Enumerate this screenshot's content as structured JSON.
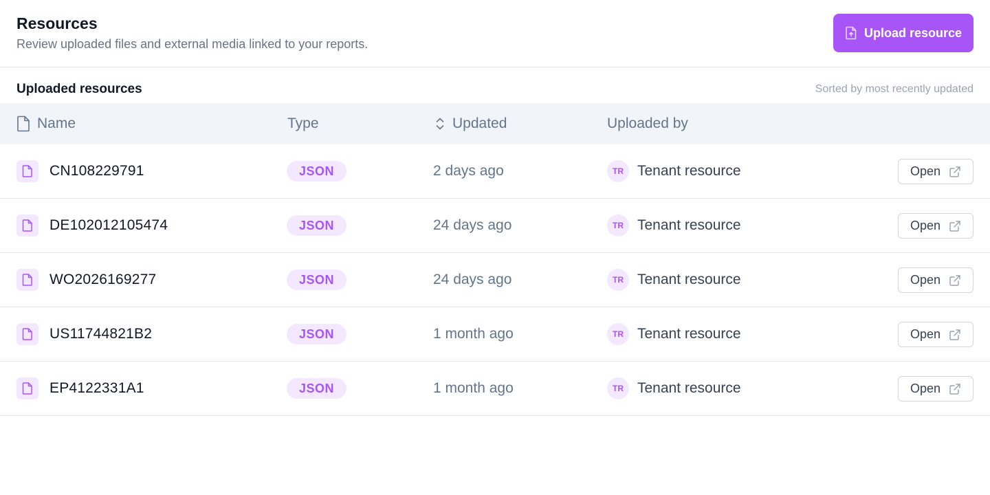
{
  "header": {
    "title": "Resources",
    "subtitle": "Review uploaded files and external media linked to your reports.",
    "upload_label": "Upload resource"
  },
  "section": {
    "title": "Uploaded resources",
    "sort_note": "Sorted by most recently updated"
  },
  "table": {
    "columns": {
      "name": "Name",
      "type": "Type",
      "updated": "Updated",
      "uploaded_by": "Uploaded by"
    },
    "rows": [
      {
        "name": "CN108229791",
        "type": "JSON",
        "updated": "2 days ago",
        "avatar": "TR",
        "uploader": "Tenant resource",
        "action": "Open"
      },
      {
        "name": "DE102012105474",
        "type": "JSON",
        "updated": "24 days ago",
        "avatar": "TR",
        "uploader": "Tenant resource",
        "action": "Open"
      },
      {
        "name": "WO2026169277",
        "type": "JSON",
        "updated": "24 days ago",
        "avatar": "TR",
        "uploader": "Tenant resource",
        "action": "Open"
      },
      {
        "name": "US11744821B2",
        "type": "JSON",
        "updated": "1 month ago",
        "avatar": "TR",
        "uploader": "Tenant resource",
        "action": "Open"
      },
      {
        "name": "EP4122331A1",
        "type": "JSON",
        "updated": "1 month ago",
        "avatar": "TR",
        "uploader": "Tenant resource",
        "action": "Open"
      }
    ]
  },
  "icons": {
    "upload_button": "file-upload-icon",
    "name_column": "file-icon",
    "updated_column": "sort-icon",
    "row_file": "file-icon",
    "open_button": "external-link-icon"
  },
  "colors": {
    "accent": "#a855f7",
    "accent_soft": "#f3e8ff",
    "header_bg": "#f1f5f9",
    "muted_text": "#64748b"
  }
}
